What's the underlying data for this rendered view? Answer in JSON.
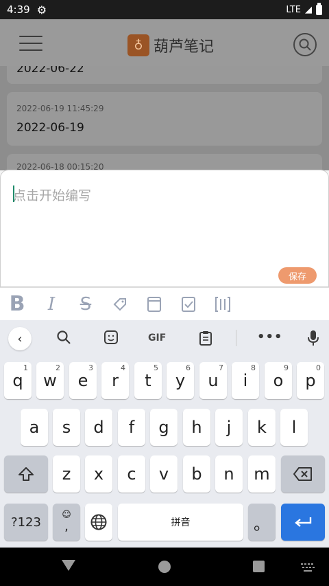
{
  "status_bar": {
    "time": "4:39",
    "network": "LTE"
  },
  "app_bar": {
    "title": "葫芦笔记",
    "logo_glyph": "♁"
  },
  "notes": [
    {
      "title": "2022-06-22"
    },
    {
      "timestamp": "2022-06-19 11:45:29",
      "title": "2022-06-19"
    },
    {
      "timestamp": "2022-06-18 00:15:20"
    }
  ],
  "editor": {
    "placeholder": "点击开始编写",
    "save_label": "保存"
  },
  "format_toolbar": [
    {
      "name": "bold-button",
      "glyph": "B"
    },
    {
      "name": "italic-button",
      "glyph": "I"
    },
    {
      "name": "strikethrough-button",
      "glyph": "S"
    },
    {
      "name": "tag-button",
      "glyph": "◇"
    },
    {
      "name": "block-button",
      "glyph": "▭"
    },
    {
      "name": "checkbox-button",
      "glyph": "☑"
    },
    {
      "name": "bracket-button",
      "glyph": "[|]"
    }
  ],
  "keyboard": {
    "suggestion_gif": "GIF",
    "row1": [
      {
        "k": "q",
        "h": "1"
      },
      {
        "k": "w",
        "h": "2"
      },
      {
        "k": "e",
        "h": "3"
      },
      {
        "k": "r",
        "h": "4"
      },
      {
        "k": "t",
        "h": "5"
      },
      {
        "k": "y",
        "h": "6"
      },
      {
        "k": "u",
        "h": "7"
      },
      {
        "k": "i",
        "h": "8"
      },
      {
        "k": "o",
        "h": "9"
      },
      {
        "k": "p",
        "h": "0"
      }
    ],
    "row2": [
      "a",
      "s",
      "d",
      "f",
      "g",
      "h",
      "j",
      "k",
      "l"
    ],
    "row3": [
      "z",
      "x",
      "c",
      "v",
      "b",
      "n",
      "m"
    ],
    "symbols_label": "?123",
    "comma_label": ",",
    "space_label": "拼音",
    "period_label": "。"
  }
}
